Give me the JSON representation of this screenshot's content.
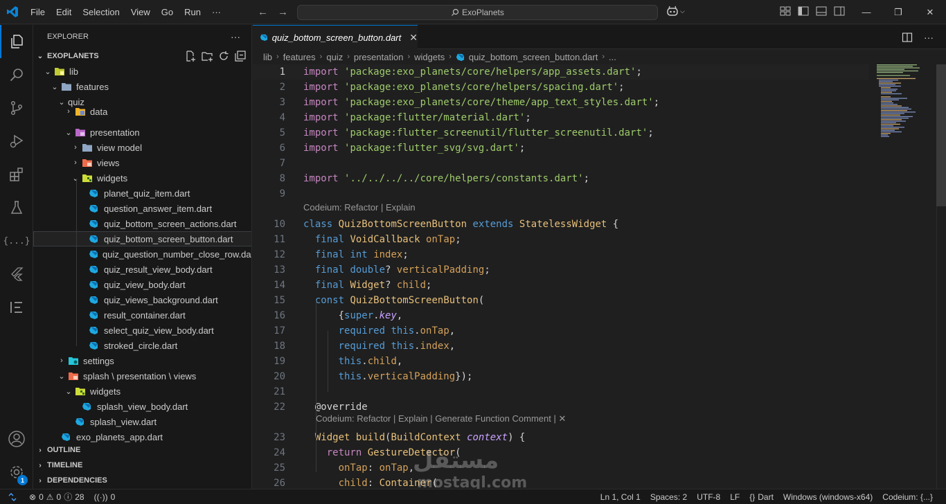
{
  "titlebar": {
    "menu": [
      "File",
      "Edit",
      "Selection",
      "View",
      "Go",
      "Run",
      "···"
    ],
    "search_text": "ExoPlanets"
  },
  "activity_bar": {
    "items": [
      "files-icon",
      "search-icon",
      "source-control-icon",
      "run-debug-icon",
      "extensions-icon",
      "testing-icon",
      "json-icon",
      "flutter-icon",
      "codeium-icon"
    ],
    "bottom": [
      "account-icon",
      "manage-icon"
    ],
    "manage_badge": "1"
  },
  "sidebar": {
    "title": "EXPLORER",
    "more": "···",
    "project": "EXOPLANETS",
    "tree": [
      {
        "label": "lib",
        "indent": 1,
        "chevron": "down",
        "icon": "folder-lib"
      },
      {
        "label": "features",
        "indent": 2,
        "chevron": "down",
        "icon": "folder"
      },
      {
        "label": "quiz",
        "indent": 3,
        "chevron": "down",
        "icon": "none"
      },
      {
        "label": "data",
        "indent": 4,
        "chevron": "right",
        "icon": "folder-data",
        "partial": true
      },
      {
        "label": "presentation",
        "indent": 4,
        "chevron": "down",
        "icon": "folder-presentation"
      },
      {
        "label": "view model",
        "indent": 5,
        "chevron": "right",
        "icon": "folder"
      },
      {
        "label": "views",
        "indent": 5,
        "chevron": "right",
        "icon": "folder-views"
      },
      {
        "label": "widgets",
        "indent": 5,
        "chevron": "down",
        "icon": "folder-widgets"
      },
      {
        "label": "planet_quiz_item.dart",
        "indent": 6,
        "icon": "dart"
      },
      {
        "label": "question_answer_item.dart",
        "indent": 6,
        "icon": "dart"
      },
      {
        "label": "quiz_bottom_screen_actions.dart",
        "indent": 6,
        "icon": "dart"
      },
      {
        "label": "quiz_bottom_screen_button.dart",
        "indent": 6,
        "icon": "dart",
        "selected": true
      },
      {
        "label": "quiz_question_number_close_row.dart",
        "indent": 6,
        "icon": "dart"
      },
      {
        "label": "quiz_result_view_body.dart",
        "indent": 6,
        "icon": "dart"
      },
      {
        "label": "quiz_view_body.dart",
        "indent": 6,
        "icon": "dart"
      },
      {
        "label": "quiz_views_background.dart",
        "indent": 6,
        "icon": "dart"
      },
      {
        "label": "result_container.dart",
        "indent": 6,
        "icon": "dart"
      },
      {
        "label": "select_quiz_view_body.dart",
        "indent": 6,
        "icon": "dart"
      },
      {
        "label": "stroked_circle.dart",
        "indent": 6,
        "icon": "dart"
      },
      {
        "label": "settings",
        "indent": 3,
        "chevron": "right",
        "icon": "folder-settings"
      },
      {
        "label": "splash \\ presentation \\ views",
        "indent": 3,
        "chevron": "down",
        "icon": "folder-views"
      },
      {
        "label": "widgets",
        "indent": 4,
        "chevron": "down",
        "icon": "folder-widgets"
      },
      {
        "label": "splash_view_body.dart",
        "indent": 5,
        "icon": "dart"
      },
      {
        "label": "splash_view.dart",
        "indent": 4,
        "icon": "dart"
      },
      {
        "label": "exo_planets_app.dart",
        "indent": 2,
        "icon": "dart"
      }
    ],
    "sections": [
      "OUTLINE",
      "TIMELINE",
      "DEPENDENCIES"
    ]
  },
  "editor": {
    "tab_label": "quiz_bottom_screen_button.dart",
    "breadcrumb": [
      "lib",
      "features",
      "quiz",
      "presentation",
      "widgets",
      "quiz_bottom_screen_button.dart",
      "..."
    ],
    "codelens_1": "Codeium: Refactor | Explain",
    "codelens_2": "Codeium: Refactor | Explain | Generate Function Comment | ✕",
    "lines": [
      {
        "n": "1",
        "text": "import 'package:exo_planets/core/helpers/app_assets.dart';"
      },
      {
        "n": "2",
        "text": "import 'package:exo_planets/core/helpers/spacing.dart';"
      },
      {
        "n": "3",
        "text": "import 'package:exo_planets/core/theme/app_text_styles.dart';"
      },
      {
        "n": "4",
        "text": "import 'package:flutter/material.dart';"
      },
      {
        "n": "5",
        "text": "import 'package:flutter_screenutil/flutter_screenutil.dart';"
      },
      {
        "n": "6",
        "text": "import 'package:flutter_svg/svg.dart';"
      },
      {
        "n": "7",
        "text": ""
      },
      {
        "n": "8",
        "text": "import '../../../../core/helpers/constants.dart';"
      },
      {
        "n": "9",
        "text": ""
      },
      {
        "n": "10",
        "text": "class QuizBottomScreenButton extends StatelessWidget {"
      },
      {
        "n": "11",
        "text": "  final VoidCallback onTap;"
      },
      {
        "n": "12",
        "text": "  final int index;"
      },
      {
        "n": "13",
        "text": "  final double? verticalPadding;"
      },
      {
        "n": "14",
        "text": "  final Widget? child;"
      },
      {
        "n": "15",
        "text": "  const QuizBottomScreenButton("
      },
      {
        "n": "16",
        "text": "      {super.key,"
      },
      {
        "n": "17",
        "text": "      required this.onTap,"
      },
      {
        "n": "18",
        "text": "      required this.index,"
      },
      {
        "n": "19",
        "text": "      this.child,"
      },
      {
        "n": "20",
        "text": "      this.verticalPadding});"
      },
      {
        "n": "21",
        "text": ""
      },
      {
        "n": "22",
        "text": "  @override"
      },
      {
        "n": "23",
        "text": "  Widget build(BuildContext context) {"
      },
      {
        "n": "24",
        "text": "    return GestureDetector("
      },
      {
        "n": "25",
        "text": "      onTap: onTap,"
      },
      {
        "n": "26",
        "text": "      child: Container("
      }
    ]
  },
  "statusbar": {
    "errors": "0",
    "warnings": "0",
    "info": "28",
    "ports": "0",
    "position": "Ln 1, Col 1",
    "spaces": "Spaces: 2",
    "encoding": "UTF-8",
    "eol": "LF",
    "language": "Dart",
    "platform": "Windows (windows-x64)",
    "codeium": "Codeium: {...}"
  },
  "watermark": {
    "arabic": "مستقل",
    "latin": "mostaql.com"
  }
}
